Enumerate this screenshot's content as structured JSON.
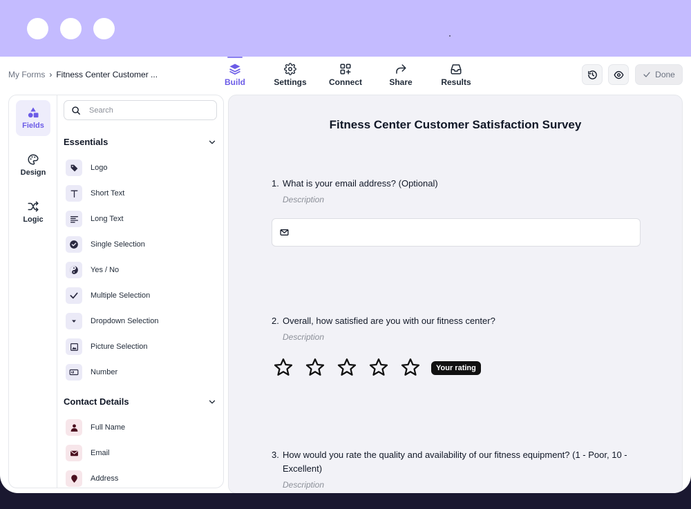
{
  "breadcrumb": {
    "root": "My Forms",
    "separator": "›",
    "current": "Fitness Center Customer ..."
  },
  "nav_tabs": [
    {
      "label": "Build",
      "icon": "layers-icon",
      "active": true
    },
    {
      "label": "Settings",
      "icon": "gear-icon",
      "active": false
    },
    {
      "label": "Connect",
      "icon": "grid-plus-icon",
      "active": false
    },
    {
      "label": "Share",
      "icon": "share-arrow-icon",
      "active": false
    },
    {
      "label": "Results",
      "icon": "inbox-icon",
      "active": false
    }
  ],
  "toolbar": {
    "history_icon": "history-icon",
    "preview_icon": "eye-icon",
    "done_label": "Done"
  },
  "rail": [
    {
      "label": "Fields",
      "icon": "shapes-icon",
      "active": true
    },
    {
      "label": "Design",
      "icon": "palette-icon",
      "active": false
    },
    {
      "label": "Logic",
      "icon": "shuffle-icon",
      "active": false
    }
  ],
  "search": {
    "placeholder": "Search",
    "value": ""
  },
  "sections": [
    {
      "title": "Essentials",
      "items": [
        {
          "label": "Logo",
          "icon": "tag-icon"
        },
        {
          "label": "Short Text",
          "icon": "text-t-icon"
        },
        {
          "label": "Long Text",
          "icon": "paragraph-icon"
        },
        {
          "label": "Single Selection",
          "icon": "check-circle-icon"
        },
        {
          "label": "Yes / No",
          "icon": "yin-yang-icon"
        },
        {
          "label": "Multiple Selection",
          "icon": "checkmark-icon"
        },
        {
          "label": "Dropdown Selection",
          "icon": "caret-down-icon"
        },
        {
          "label": "Picture Selection",
          "icon": "image-icon"
        },
        {
          "label": "Number",
          "icon": "number-input-icon"
        }
      ]
    },
    {
      "title": "Contact Details",
      "items": [
        {
          "label": "Full Name",
          "icon": "person-icon"
        },
        {
          "label": "Email",
          "icon": "envelope-icon"
        },
        {
          "label": "Address",
          "icon": "map-pin-icon"
        }
      ]
    }
  ],
  "form": {
    "title": "Fitness Center Customer Satisfaction Survey",
    "questions": [
      {
        "number": "1.",
        "text": "What is your email address? (Optional)",
        "description": "Description"
      },
      {
        "number": "2.",
        "text": "Overall, how satisfied are you with our fitness center?",
        "description": "Description",
        "stars": 5,
        "rating_badge": "Your rating"
      },
      {
        "number": "3.",
        "text": "How would you rate the quality and availability of our fitness equipment? (1 - Poor, 10 - Excellent)",
        "description": "Description"
      }
    ]
  },
  "colors": {
    "titlebar": "#c4bbff",
    "accent": "#6c5ce7",
    "canvas": "#f2f2f7",
    "backdrop": "#1a1830"
  }
}
